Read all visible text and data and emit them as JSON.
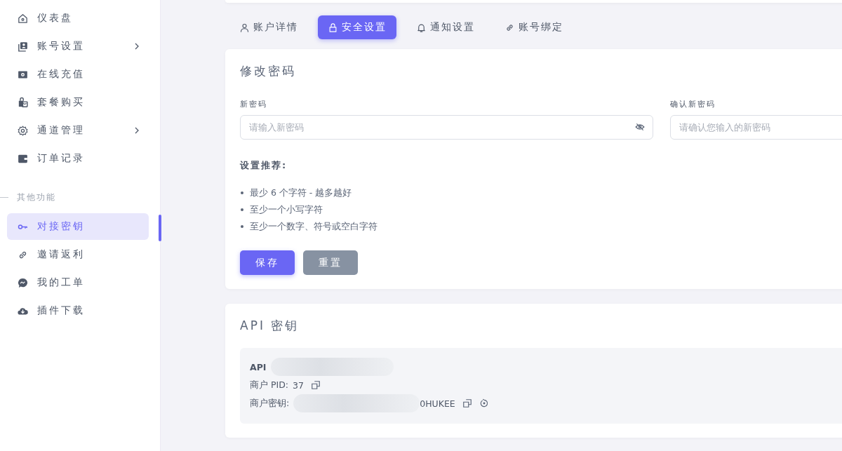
{
  "sidebar": {
    "items": [
      {
        "label": "仪表盘",
        "submenu": false,
        "selected": false
      },
      {
        "label": "账号设置",
        "submenu": true,
        "selected": false
      },
      {
        "label": "在线充值",
        "submenu": false,
        "selected": false
      },
      {
        "label": "套餐购买",
        "submenu": false,
        "selected": false
      },
      {
        "label": "通道管理",
        "submenu": true,
        "selected": false
      },
      {
        "label": "订单记录",
        "submenu": false,
        "selected": false
      }
    ],
    "section": "其他功能",
    "section_items": [
      {
        "label": "对接密钥",
        "submenu": false,
        "selected": true
      },
      {
        "label": "邀请返利",
        "submenu": false,
        "selected": false
      },
      {
        "label": "我的工单",
        "submenu": false,
        "selected": false
      },
      {
        "label": "插件下载",
        "submenu": false,
        "selected": false
      }
    ]
  },
  "tabs": [
    {
      "label": "账户详情",
      "selected": false
    },
    {
      "label": "安全设置",
      "selected": true
    },
    {
      "label": "通知设置",
      "selected": false
    },
    {
      "label": "账号绑定",
      "selected": false
    }
  ],
  "password_card": {
    "title": "修改密码",
    "fields": [
      {
        "label": "新密码",
        "placeholder": "请输入新密码",
        "toggle": true
      },
      {
        "label": "确认新密码",
        "placeholder": "请确认您输入的新密码",
        "toggle": false
      }
    ],
    "tips_title": "设置推荐:",
    "tips": [
      "最少 6 个字符 - 越多越好",
      "至少一个小写字符",
      "至少一个数字、符号或空白字符"
    ],
    "buttons": [
      {
        "kind": "primary",
        "label": "保存"
      },
      {
        "kind": "secondary",
        "label": "重置"
      }
    ]
  },
  "api_card": {
    "title": "API 密钥",
    "rows": [
      {
        "label": "API",
        "redacted": true,
        "copy": false,
        "reset": false
      },
      {
        "label": "商户 PID:",
        "value": "37",
        "redacted": false,
        "copy": true,
        "reset": false
      },
      {
        "label": "商户密钥:",
        "value": "0HUKEE",
        "redacted": true,
        "copy": true,
        "reset": true
      }
    ]
  }
}
